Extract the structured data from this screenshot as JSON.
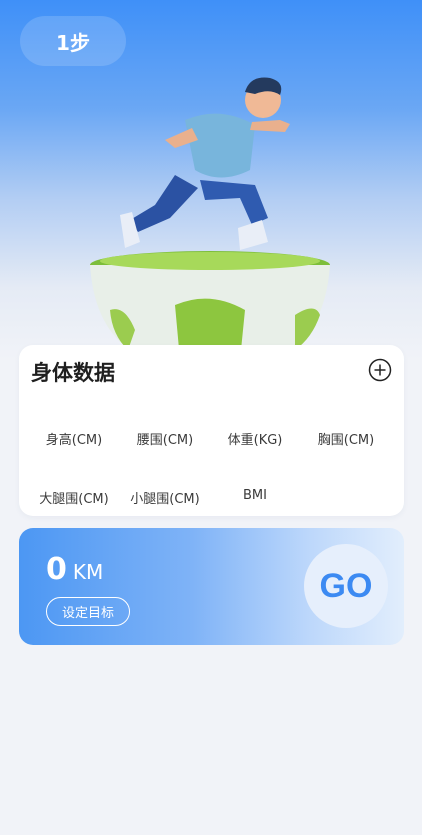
{
  "header": {
    "steps_label": "1步"
  },
  "body_data": {
    "title": "身体数据",
    "add_icon": "plus-circle-icon",
    "metrics": [
      "身高(CM)",
      "腰围(CM)",
      "体重(KG)",
      "胸围(CM)",
      "大腿围(CM)",
      "小腿围(CM)",
      "BMI"
    ]
  },
  "distance": {
    "value": "0",
    "unit": "KM",
    "set_goal_label": "设定目标",
    "go_label": "GO"
  },
  "colors": {
    "accent": "#3f90f8",
    "go_text": "#3c8af2"
  }
}
